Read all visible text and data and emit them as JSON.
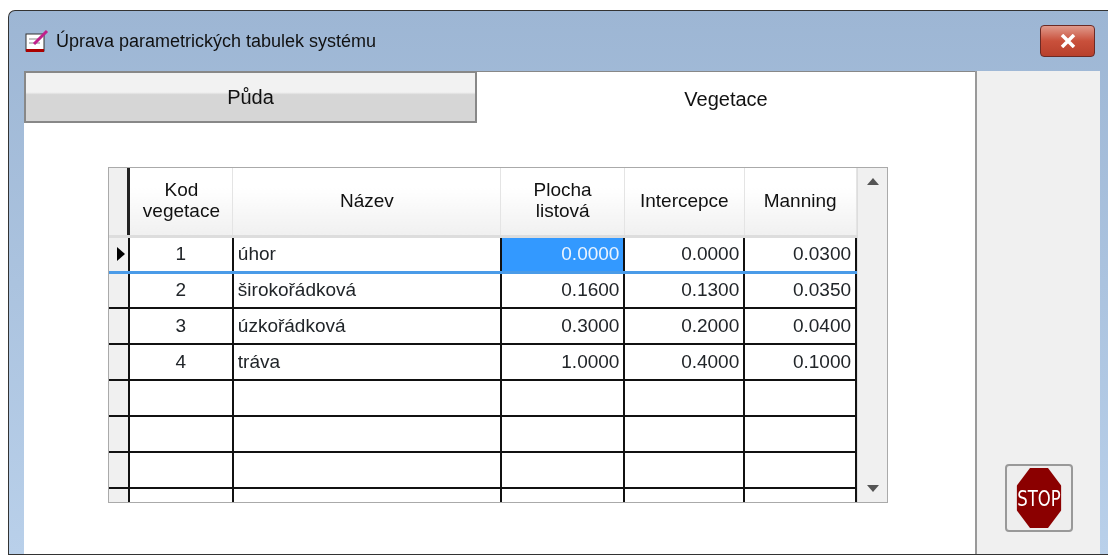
{
  "window": {
    "title": "Úprava parametrických tabulek systému"
  },
  "tabs": [
    {
      "label": "Půda",
      "selected": false
    },
    {
      "label": "Vegetace",
      "selected": true
    }
  ],
  "table": {
    "columns": [
      "Kod vegetace",
      "Název",
      "Plocha listová",
      "Intercepce",
      "Manning"
    ],
    "rows": [
      {
        "current": true,
        "cells": [
          {
            "text": "1",
            "selected": false
          },
          {
            "text": "úhor",
            "selected": false
          },
          {
            "text": "0.0000",
            "selected": true
          },
          {
            "text": "0.0000",
            "selected": false
          },
          {
            "text": "0.0300",
            "selected": false
          }
        ]
      },
      {
        "current": false,
        "cells": [
          {
            "text": "2",
            "selected": false
          },
          {
            "text": "širokořádková",
            "selected": false
          },
          {
            "text": "0.1600",
            "selected": false
          },
          {
            "text": "0.1300",
            "selected": false
          },
          {
            "text": "0.0350",
            "selected": false
          }
        ]
      },
      {
        "current": false,
        "cells": [
          {
            "text": "3",
            "selected": false
          },
          {
            "text": "úzkořádková",
            "selected": false
          },
          {
            "text": "0.3000",
            "selected": false
          },
          {
            "text": "0.2000",
            "selected": false
          },
          {
            "text": "0.0400",
            "selected": false
          }
        ]
      },
      {
        "current": false,
        "cells": [
          {
            "text": "4",
            "selected": false
          },
          {
            "text": "tráva",
            "selected": false
          },
          {
            "text": "1.0000",
            "selected": false
          },
          {
            "text": "0.4000",
            "selected": false
          },
          {
            "text": "0.1000",
            "selected": false
          }
        ]
      }
    ]
  },
  "stop_button": {
    "label": "STOP"
  }
}
